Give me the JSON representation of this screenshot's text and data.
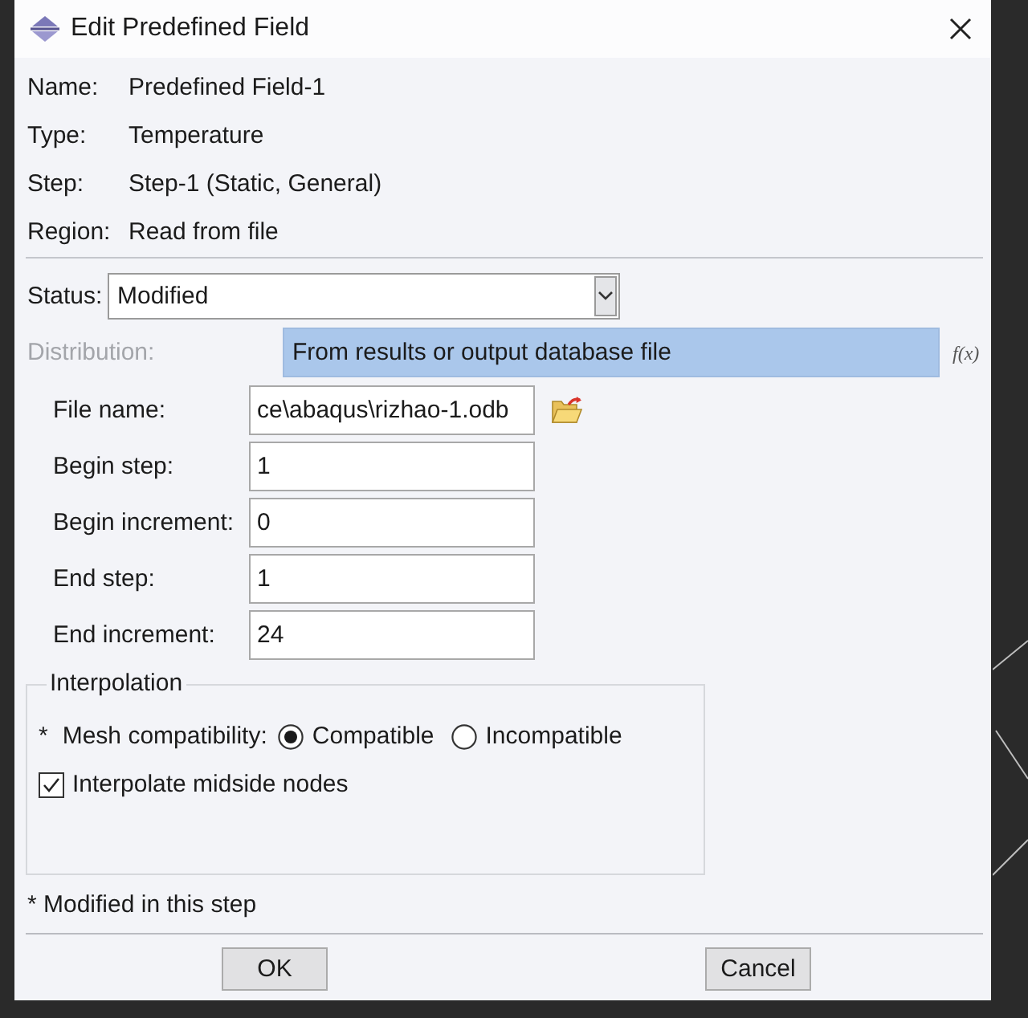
{
  "window": {
    "title": "Edit Predefined Field"
  },
  "info": [
    {
      "label": "Name:",
      "value": "Predefined Field-1"
    },
    {
      "label": "Type:",
      "value": "Temperature"
    },
    {
      "label": "Step:",
      "value": "Step-1 (Static, General)"
    },
    {
      "label": "Region:",
      "value": "Read from file"
    }
  ],
  "status": {
    "label": "Status:",
    "value": "Modified"
  },
  "distribution": {
    "label": "Distribution:",
    "disabled": true,
    "value": "From results or output database file",
    "function_button": "f(x)"
  },
  "file_fields": [
    {
      "kind": "file",
      "label": "File name:",
      "value": "ce\\abaqus\\rizhao-1.odb"
    },
    {
      "kind": "text",
      "label": "Begin step:",
      "value": "1"
    },
    {
      "kind": "text",
      "label": "Begin increment:",
      "value": "0"
    },
    {
      "kind": "text",
      "label": "End step:",
      "value": "1"
    },
    {
      "kind": "text",
      "label": "End increment:",
      "value": "24"
    }
  ],
  "interpolation": {
    "title": "Interpolation",
    "mesh_compatibility": {
      "marker": "*",
      "label": "Mesh compatibility:",
      "options": [
        {
          "label": "Compatible",
          "selected": true
        },
        {
          "label": "Incompatible",
          "selected": false
        }
      ]
    },
    "midside_nodes": {
      "label": "Interpolate midside nodes",
      "checked": true
    }
  },
  "footnote": "* Modified in this step",
  "buttons": [
    "OK",
    "Cancel"
  ]
}
